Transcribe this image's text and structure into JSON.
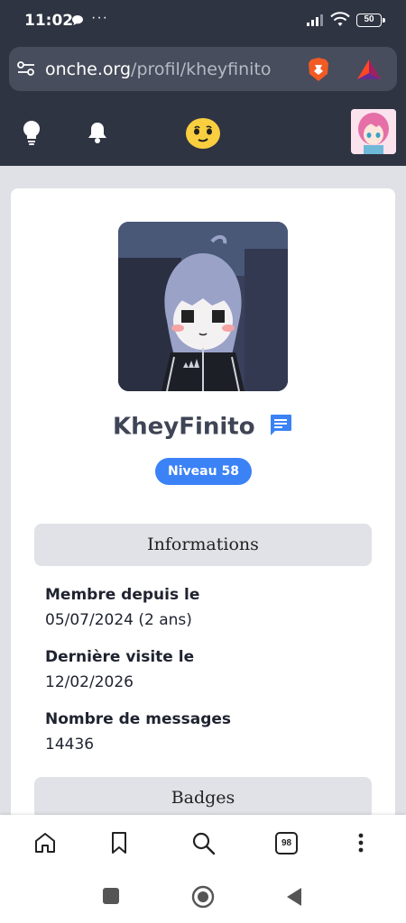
{
  "status_bar": {
    "time": "11:02",
    "more": "···",
    "battery": "50"
  },
  "browser": {
    "url_domain": "onche.org",
    "url_path": "/profil/kheyfinito",
    "tabs_count": "98"
  },
  "site_nav": {
    "icons": [
      "lightbulb-icon",
      "bell-icon",
      "onche-logo",
      "user-avatar"
    ]
  },
  "profile": {
    "username": "KheyFinito",
    "level": "Niveau 58"
  },
  "informations": {
    "heading": "Informations",
    "member_since_label": "Membre depuis le",
    "member_since_value": "05/07/2024 (2 ans)",
    "last_visit_label": "Dernière visite le",
    "last_visit_value": "12/02/2026",
    "messages_label": "Nombre de messages",
    "messages_value": "14436"
  },
  "badges": {
    "heading": "Badges"
  },
  "colors": {
    "header_bg": "#2f3442",
    "url_bar_bg": "#474d5c",
    "accent_blue": "#3b82f6",
    "page_bg": "#dfe1e6",
    "section_bg": "#e0e2e7"
  }
}
